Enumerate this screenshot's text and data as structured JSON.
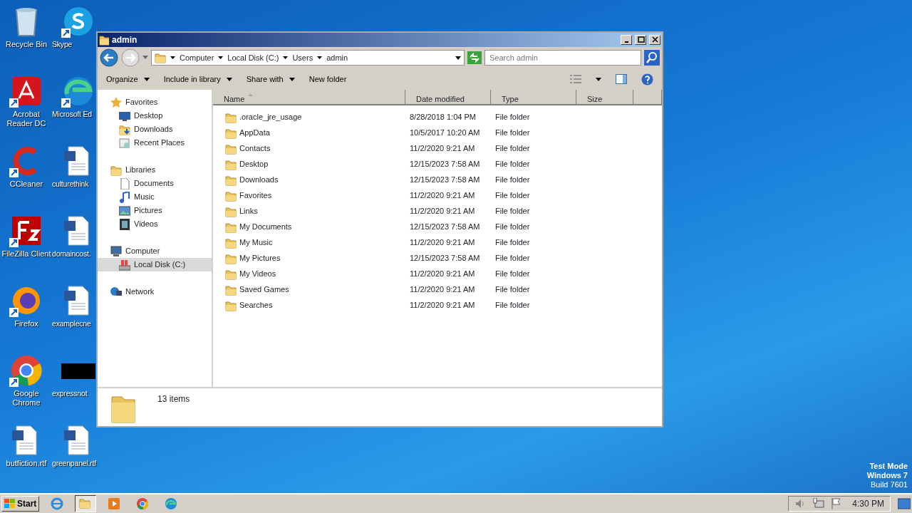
{
  "desktop_icons": [
    {
      "label": "Recycle Bin",
      "kind": "recycle",
      "shortcut": false
    },
    {
      "label": "Skype",
      "kind": "skype",
      "shortcut": true
    },
    {
      "label": "Acrobat Reader DC",
      "kind": "pdf",
      "shortcut": true
    },
    {
      "label": "Microsoft Ed",
      "kind": "edge",
      "shortcut": true
    },
    {
      "label": "CCleaner",
      "kind": "ccleaner",
      "shortcut": true
    },
    {
      "label": "culturethink",
      "kind": "word",
      "shortcut": false
    },
    {
      "label": "FileZilla Client",
      "kind": "filezilla",
      "shortcut": true
    },
    {
      "label": "domaincost.",
      "kind": "word",
      "shortcut": false
    },
    {
      "label": "Firefox",
      "kind": "firefox",
      "shortcut": true
    },
    {
      "label": "examplecne",
      "kind": "word",
      "shortcut": false
    },
    {
      "label": "Google Chrome",
      "kind": "chrome",
      "shortcut": true
    },
    {
      "label": "expressnot",
      "kind": "dark",
      "shortcut": false
    },
    {
      "label": "butfiction.rtf",
      "kind": "word",
      "shortcut": false
    },
    {
      "label": "greenpanel.rtf",
      "kind": "word",
      "shortcut": false
    }
  ],
  "window": {
    "title": "admin",
    "breadcrumbs": [
      "Computer",
      "Local Disk (C:)",
      "Users",
      "admin"
    ],
    "search": {
      "placeholder": "Search admin"
    },
    "toolbar": [
      {
        "label": "Organize",
        "dropdown": true
      },
      {
        "label": "Include in library",
        "dropdown": true
      },
      {
        "label": "Share with",
        "dropdown": true
      },
      {
        "label": "New folder",
        "dropdown": false
      }
    ],
    "navigation": [
      {
        "label": "Favorites",
        "kind": "star",
        "selected": false,
        "children": [
          {
            "label": "Desktop",
            "kind": "desktop",
            "selected": false
          },
          {
            "label": "Downloads",
            "kind": "downloads",
            "selected": false
          },
          {
            "label": "Recent Places",
            "kind": "recent",
            "selected": false
          }
        ]
      },
      {
        "label": "Libraries",
        "kind": "library",
        "selected": false,
        "children": [
          {
            "label": "Documents",
            "kind": "document",
            "selected": false
          },
          {
            "label": "Music",
            "kind": "music",
            "selected": false
          },
          {
            "label": "Pictures",
            "kind": "pictures",
            "selected": false
          },
          {
            "label": "Videos",
            "kind": "videos",
            "selected": false
          }
        ]
      },
      {
        "label": "Computer",
        "kind": "computer",
        "selected": false,
        "children": [
          {
            "label": "Local Disk (C:)",
            "kind": "disk",
            "selected": true
          }
        ]
      },
      {
        "label": "Network",
        "kind": "network",
        "selected": false
      }
    ],
    "columns": [
      {
        "label": "Name",
        "sorted": true
      },
      {
        "label": "Date modified",
        "sorted": false
      },
      {
        "label": "Type",
        "sorted": false
      },
      {
        "label": "Size",
        "sorted": false
      }
    ],
    "rows": [
      {
        "name": ".oracle_jre_usage",
        "date": "8/28/2018 1:04 PM",
        "type": "File folder"
      },
      {
        "name": "AppData",
        "date": "10/5/2017 10:20 AM",
        "type": "File folder"
      },
      {
        "name": "Contacts",
        "date": "11/2/2020 9:21 AM",
        "type": "File folder"
      },
      {
        "name": "Desktop",
        "date": "12/15/2023 7:58 AM",
        "type": "File folder"
      },
      {
        "name": "Downloads",
        "date": "12/15/2023 7:58 AM",
        "type": "File folder"
      },
      {
        "name": "Favorites",
        "date": "11/2/2020 9:21 AM",
        "type": "File folder"
      },
      {
        "name": "Links",
        "date": "11/2/2020 9:21 AM",
        "type": "File folder"
      },
      {
        "name": "My Documents",
        "date": "12/15/2023 7:58 AM",
        "type": "File folder"
      },
      {
        "name": "My Music",
        "date": "11/2/2020 9:21 AM",
        "type": "File folder"
      },
      {
        "name": "My Pictures",
        "date": "12/15/2023 7:58 AM",
        "type": "File folder"
      },
      {
        "name": "My Videos",
        "date": "11/2/2020 9:21 AM",
        "type": "File folder"
      },
      {
        "name": "Saved Games",
        "date": "11/2/2020 9:21 AM",
        "type": "File folder"
      },
      {
        "name": "Searches",
        "date": "11/2/2020 9:21 AM",
        "type": "File folder"
      }
    ],
    "status": "13 items"
  },
  "os_notice": [
    "Test Mode",
    "Windows 7",
    "Build 7601"
  ],
  "taskbar": {
    "start": "Start",
    "apps": [
      {
        "kind": "ie",
        "active": false
      },
      {
        "kind": "explorer",
        "active": true
      },
      {
        "kind": "media",
        "active": false
      },
      {
        "kind": "chrome",
        "active": false
      },
      {
        "kind": "edge",
        "active": false
      }
    ],
    "clock": "4:30 PM"
  }
}
